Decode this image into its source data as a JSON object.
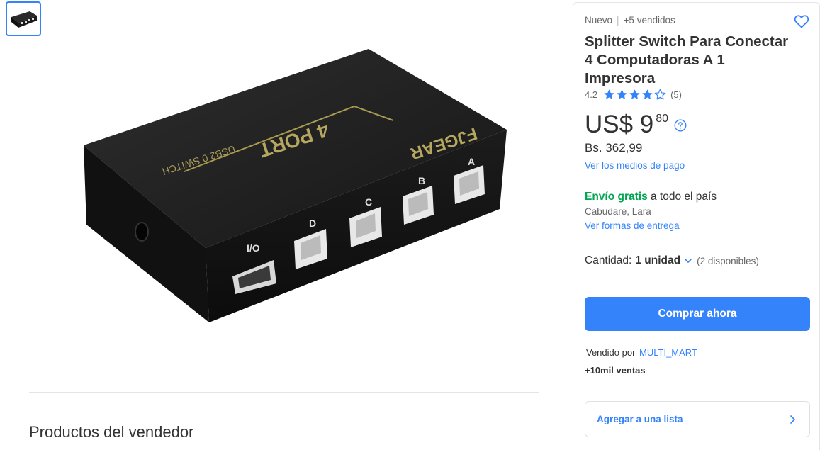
{
  "gallery": {
    "thumbnail_icon": "product-thumbnail",
    "device_labels": {
      "top_port": "4 PORT",
      "top_model": "USB2.0 SWITCH",
      "front_brand": "FJGEAR",
      "port_io": "I/O",
      "port_d": "D",
      "port_c": "C",
      "port_b": "B",
      "port_a": "A"
    }
  },
  "seller_products": {
    "title": "Productos del vendedor"
  },
  "product": {
    "condition": "Nuevo",
    "separator": "|",
    "sold": "+5 vendidos",
    "title": "Splitter Switch Para Conectar 4 Computadoras A 1 Impresora",
    "rating": {
      "value": "4.2",
      "stars_filled": 4,
      "stars_total": 5,
      "count": "(5)"
    },
    "price": {
      "currency_amount": "US$ 9",
      "cents": "80",
      "local": "Bs. 362,99"
    },
    "payment_link": "Ver los medios de pago",
    "shipping": {
      "free_label": "Envío gratis",
      "rest": " a todo el país",
      "location": "Cabudare, Lara",
      "link": "Ver formas de entrega"
    },
    "quantity": {
      "label": "Cantidad:",
      "value": "1 unidad",
      "available": "(2 disponibles)"
    },
    "buy_button": "Comprar ahora",
    "seller": {
      "label": "Vendido por",
      "name": "MULTI_MART",
      "sales": "+10mil ventas"
    },
    "add_to_list": "Agregar a una lista"
  },
  "colors": {
    "accent": "#3483fa",
    "free_shipping": "#00a650",
    "text": "#333333",
    "muted": "#666666"
  }
}
